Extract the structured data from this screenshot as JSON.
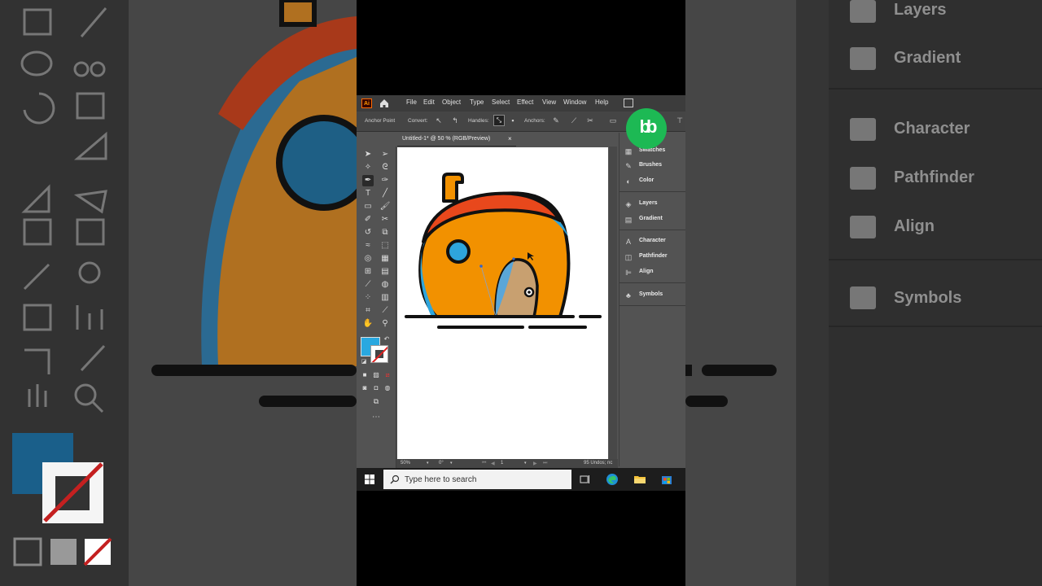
{
  "menubar": {
    "logo": "Ai",
    "items": [
      "File",
      "Edit",
      "Object",
      "Type",
      "Select",
      "Effect",
      "View",
      "Window",
      "Help"
    ]
  },
  "control_bar": {
    "anchor_point": "Anchor Point",
    "convert": "Convert:",
    "handles": "Handles:",
    "anchors": "Anchors:"
  },
  "document": {
    "tab_title": "Untitled-1* @ 50 % (RGB/Preview)",
    "close": "×"
  },
  "status": {
    "zoom": "50%",
    "rotation": "0°",
    "artboard_num": "1",
    "undos": "95 Undos; nc"
  },
  "panels": {
    "items": [
      {
        "label": "Swatches",
        "icon": "swatches-icon"
      },
      {
        "label": "Brushes",
        "icon": "brushes-icon"
      },
      {
        "label": "Color",
        "icon": "color-icon"
      },
      {
        "label": "Layers",
        "icon": "layers-icon"
      },
      {
        "label": "Gradient",
        "icon": "gradient-icon"
      },
      {
        "label": "Character",
        "icon": "character-icon"
      },
      {
        "label": "Pathfinder",
        "icon": "pathfinder-icon"
      },
      {
        "label": "Align",
        "icon": "align-icon"
      },
      {
        "label": "Symbols",
        "icon": "symbols-icon"
      }
    ]
  },
  "background_panel": {
    "items": [
      "Layers",
      "Gradient",
      "Character",
      "Pathfinder",
      "Align",
      "Symbols"
    ]
  },
  "taskbar": {
    "search_placeholder": "Type here to search"
  },
  "colors": {
    "fill": "#29a8e0",
    "accent_orange": "#f29100",
    "accent_red": "#e8481c",
    "accent_blue": "#2ea5dc",
    "brand_green": "#1db954"
  }
}
